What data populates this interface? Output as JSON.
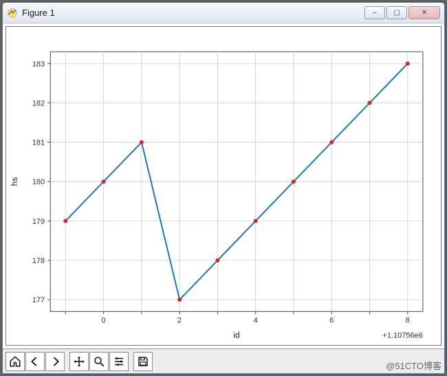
{
  "window": {
    "title": "Figure 1",
    "controls": {
      "minimize": "–",
      "maximize": "▢",
      "close": "✕"
    }
  },
  "toolbar": {
    "home": "Home",
    "back": "Back",
    "forward": "Forward",
    "pan": "Pan",
    "zoom": "Zoom",
    "configure": "Configure",
    "save": "Save"
  },
  "watermark": "@51CTO博客",
  "chart_data": {
    "type": "line",
    "xlabel": "id",
    "ylabel": "hs",
    "x_offset_text": "+1.10756e6",
    "x_offset": 1107560,
    "x_ticks": [
      -1,
      0,
      1,
      2,
      3,
      4,
      5,
      6,
      7,
      8
    ],
    "x_tick_labels": [
      "",
      "0",
      "",
      "2",
      "",
      "4",
      "",
      "6",
      "",
      "8"
    ],
    "y_ticks": [
      177,
      178,
      179,
      180,
      181,
      182,
      183
    ],
    "xlim": [
      -1.4,
      8.4
    ],
    "ylim": [
      176.7,
      183.3
    ],
    "series": [
      {
        "name": "hs",
        "color": "#1f77b4",
        "marker_color": "#d62728",
        "x": [
          -1,
          0,
          1,
          2,
          3,
          4,
          5,
          6,
          7,
          8
        ],
        "y": [
          179,
          180,
          181,
          177,
          178,
          179,
          180,
          181,
          182,
          183
        ]
      }
    ],
    "grid": true
  }
}
